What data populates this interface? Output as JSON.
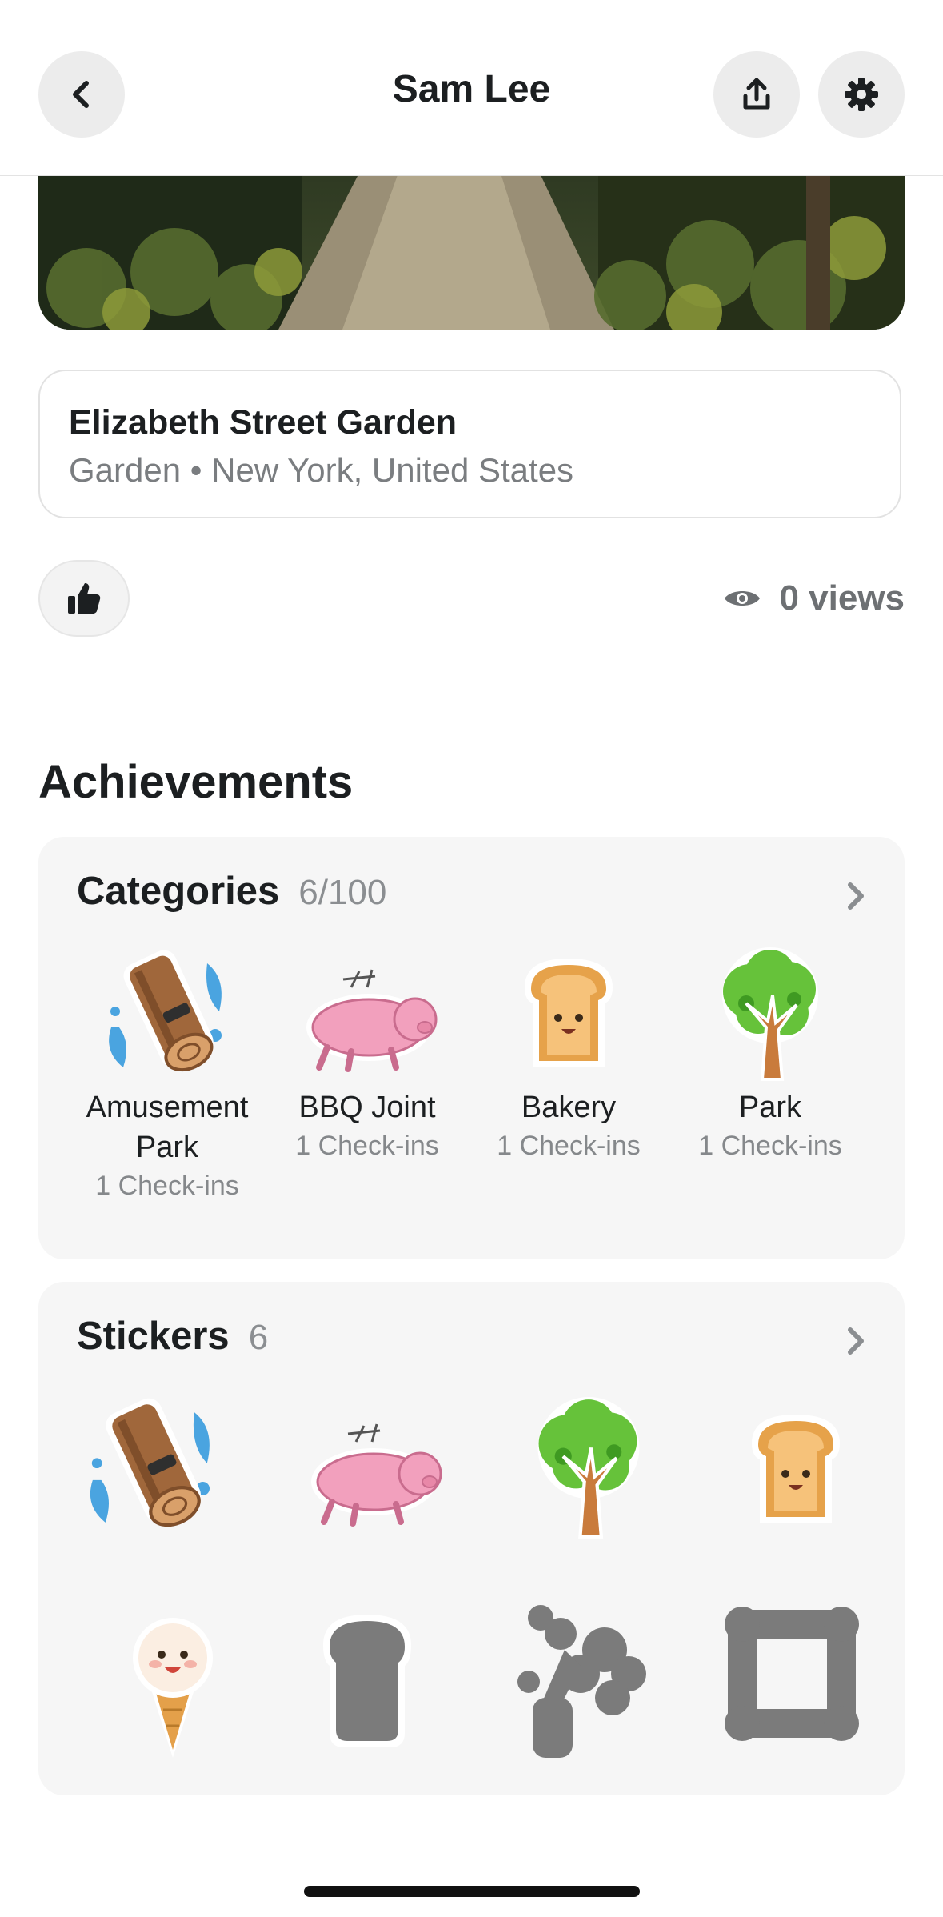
{
  "header": {
    "title": "Sam Lee",
    "icons": [
      "back-chevron-icon",
      "share-icon",
      "gear-icon"
    ]
  },
  "place": {
    "name": "Elizabeth Street Garden",
    "subtitle": "Garden • New York, United States"
  },
  "stats": {
    "views": "0 views"
  },
  "achievements": {
    "title": "Achievements",
    "categories": {
      "label": "Categories",
      "count": "6/100",
      "items": [
        {
          "name": "Amusement Park",
          "sub": "1 Check-ins",
          "icon": "log-flume-icon"
        },
        {
          "name": "BBQ Joint",
          "sub": "1 Check-ins",
          "icon": "roast-pig-icon"
        },
        {
          "name": "Bakery",
          "sub": "1 Check-ins",
          "icon": "toast-icon"
        },
        {
          "name": "Park",
          "sub": "1 Check-ins",
          "icon": "tree-icon"
        }
      ]
    },
    "stickers": {
      "label": "Stickers",
      "count": "6",
      "items": [
        {
          "icon": "log-flume-icon",
          "unlocked": true
        },
        {
          "icon": "roast-pig-icon",
          "unlocked": true
        },
        {
          "icon": "tree-icon",
          "unlocked": true
        },
        {
          "icon": "toast-icon",
          "unlocked": true
        },
        {
          "icon": "ice-cream-icon",
          "unlocked": true
        },
        {
          "icon": "locked-sticker-icon",
          "unlocked": false
        },
        {
          "icon": "locked-sticker-icon",
          "unlocked": false
        },
        {
          "icon": "locked-sticker-icon",
          "unlocked": false
        }
      ]
    }
  },
  "colors": {
    "panel": "#f6f6f6",
    "muted": "#85888b",
    "button": "#ececec",
    "locked": "#7b7b7b"
  }
}
